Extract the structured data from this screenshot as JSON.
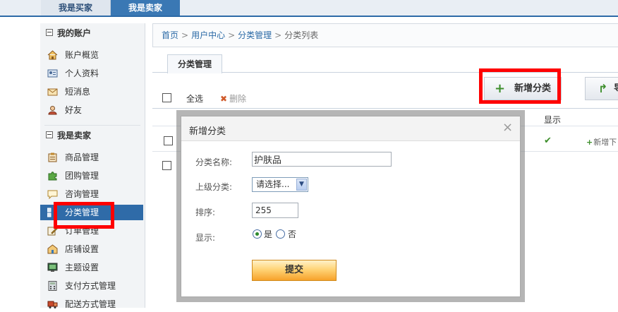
{
  "top_tabs": {
    "buyer": "我是买家",
    "seller": "我是卖家"
  },
  "sidebar": {
    "account_title": "我的账户",
    "account_items": [
      {
        "label": "账户概览",
        "icon": "home-icon"
      },
      {
        "label": "个人资料",
        "icon": "id-card-icon"
      },
      {
        "label": "短消息",
        "icon": "envelope-icon"
      },
      {
        "label": "好友",
        "icon": "user-icon"
      }
    ],
    "seller_title": "我是卖家",
    "seller_items": [
      {
        "label": "商品管理",
        "icon": "clipboard-icon"
      },
      {
        "label": "团购管理",
        "icon": "puzzle-icon"
      },
      {
        "label": "咨询管理",
        "icon": "chat-bubble-icon"
      },
      {
        "label": "分类管理",
        "icon": "grid-icon",
        "active": true
      },
      {
        "label": "订单管理",
        "icon": "edit-icon"
      },
      {
        "label": "店铺设置",
        "icon": "shop-icon"
      },
      {
        "label": "主题设置",
        "icon": "monitor-icon"
      },
      {
        "label": "支付方式管理",
        "icon": "calculator-icon"
      },
      {
        "label": "配送方式管理",
        "icon": "truck-icon"
      }
    ]
  },
  "breadcrumb": [
    "首页",
    "用户中心",
    "分类管理",
    "分类列表"
  ],
  "content_tab": "分类管理",
  "toolbar": {
    "add_category": "新增分类",
    "export_partial": "导"
  },
  "list": {
    "select_all": "全选",
    "delete": "删除",
    "col_show": "显示",
    "row1_action": "新增下"
  },
  "modal": {
    "title": "新增分类",
    "name_label": "分类名称:",
    "name_value": "护肤品",
    "parent_label": "上级分类:",
    "parent_value": "请选择...",
    "order_label": "排序:",
    "order_value": "255",
    "show_label": "显示:",
    "show_yes": "是",
    "show_no": "否",
    "submit": "提交"
  },
  "colors": {
    "accent": "#2f6ba8",
    "highlight": "#ff0000",
    "submit": "#f7a22b"
  }
}
